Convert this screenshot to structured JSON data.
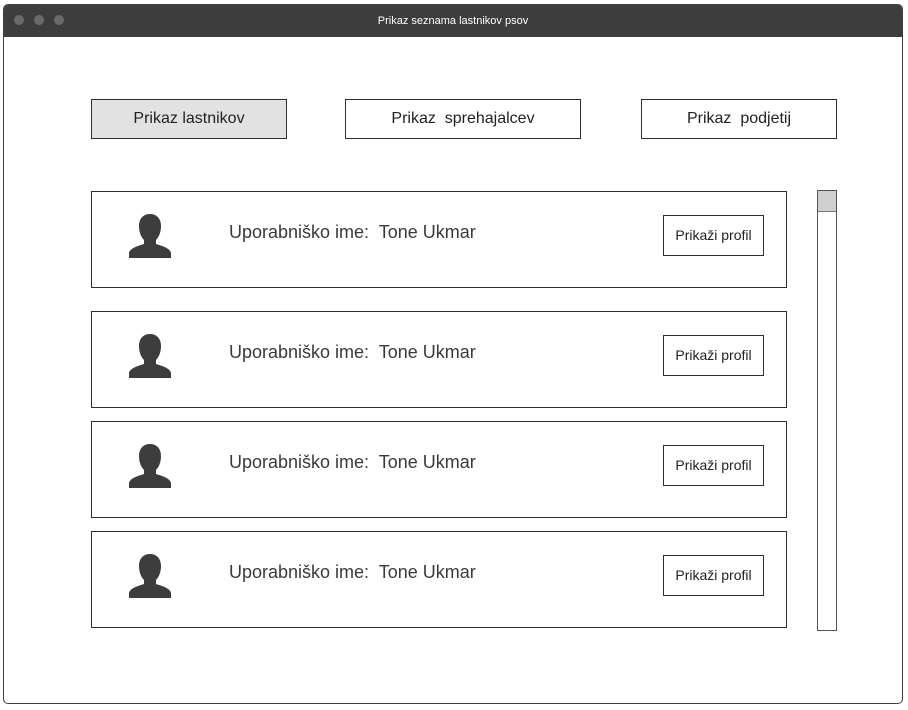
{
  "window": {
    "title": "Prikaz seznama lastnikov psov"
  },
  "tabs": [
    {
      "label": "Prikaz lastnikov",
      "active": true
    },
    {
      "label": "Prikaz  sprehajalcev",
      "active": false
    },
    {
      "label": "Prikaz  podjetij",
      "active": false
    }
  ],
  "owners": [
    {
      "label": "Uporabniško ime:  Tone Ukmar",
      "button": "Prikaži profil",
      "icon": "user-avatar-icon"
    },
    {
      "label": "Uporabniško ime:  Tone Ukmar",
      "button": "Prikaži profil",
      "icon": "user-avatar-icon"
    },
    {
      "label": "Uporabniško ime:  Tone Ukmar",
      "button": "Prikaži profil",
      "icon": "user-avatar-icon"
    },
    {
      "label": "Uporabniško ime:  Tone Ukmar",
      "button": "Prikaži profil",
      "icon": "user-avatar-icon"
    }
  ],
  "colors": {
    "titlebar": "#3d3d3d",
    "active_tab": "#e2e2e2",
    "border": "#2e2e2e",
    "icon": "#3d3d3d"
  }
}
